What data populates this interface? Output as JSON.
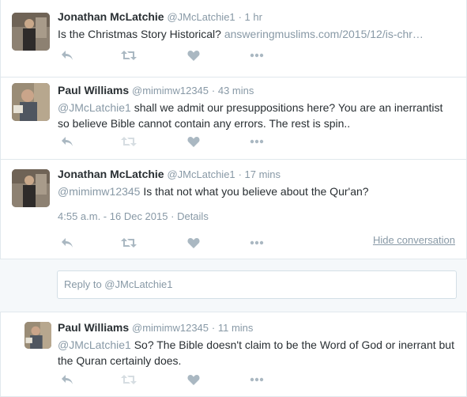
{
  "tweets": [
    {
      "fullname": "Jonathan McLatchie",
      "handle": "@JMcLatchie1",
      "time": "· 1 hr",
      "text": "Is the Christmas Story Historical?",
      "link": "answeringmuslims.com/2015/12/is-chr…"
    },
    {
      "fullname": "Paul Williams",
      "handle": "@mimimw12345",
      "time": "· 43 mins",
      "mention": "@JMcLatchie1",
      "text": "shall we admit our presuppositions here? You are an inerrantist so believe Bible cannot contain any errors. The rest is spin.."
    },
    {
      "fullname": "Jonathan McLatchie",
      "handle": "@JMcLatchie1",
      "time": "· 17 mins",
      "mention": "@mimimw12345",
      "text": "Is that not what you believe about the Qur'an?",
      "timestamp": "4:55 a.m. - 16 Dec 2015",
      "details": "Details",
      "hide": "Hide conversation"
    },
    {
      "fullname": "Paul Williams",
      "handle": "@mimimw12345",
      "time": "· 11 mins",
      "mention": "@JMcLatchie1",
      "text": "So? The Bible doesn't claim to be the Word of God or inerrant but the Quran certainly does."
    }
  ],
  "reply": {
    "placeholder": "Reply to @JMcLatchie1"
  },
  "colors": {
    "muted": "#8899a6",
    "text": "#292f33",
    "icon": "#aab8c2"
  },
  "icons": [
    "reply-icon",
    "retweet-icon",
    "like-icon",
    "more-icon"
  ]
}
